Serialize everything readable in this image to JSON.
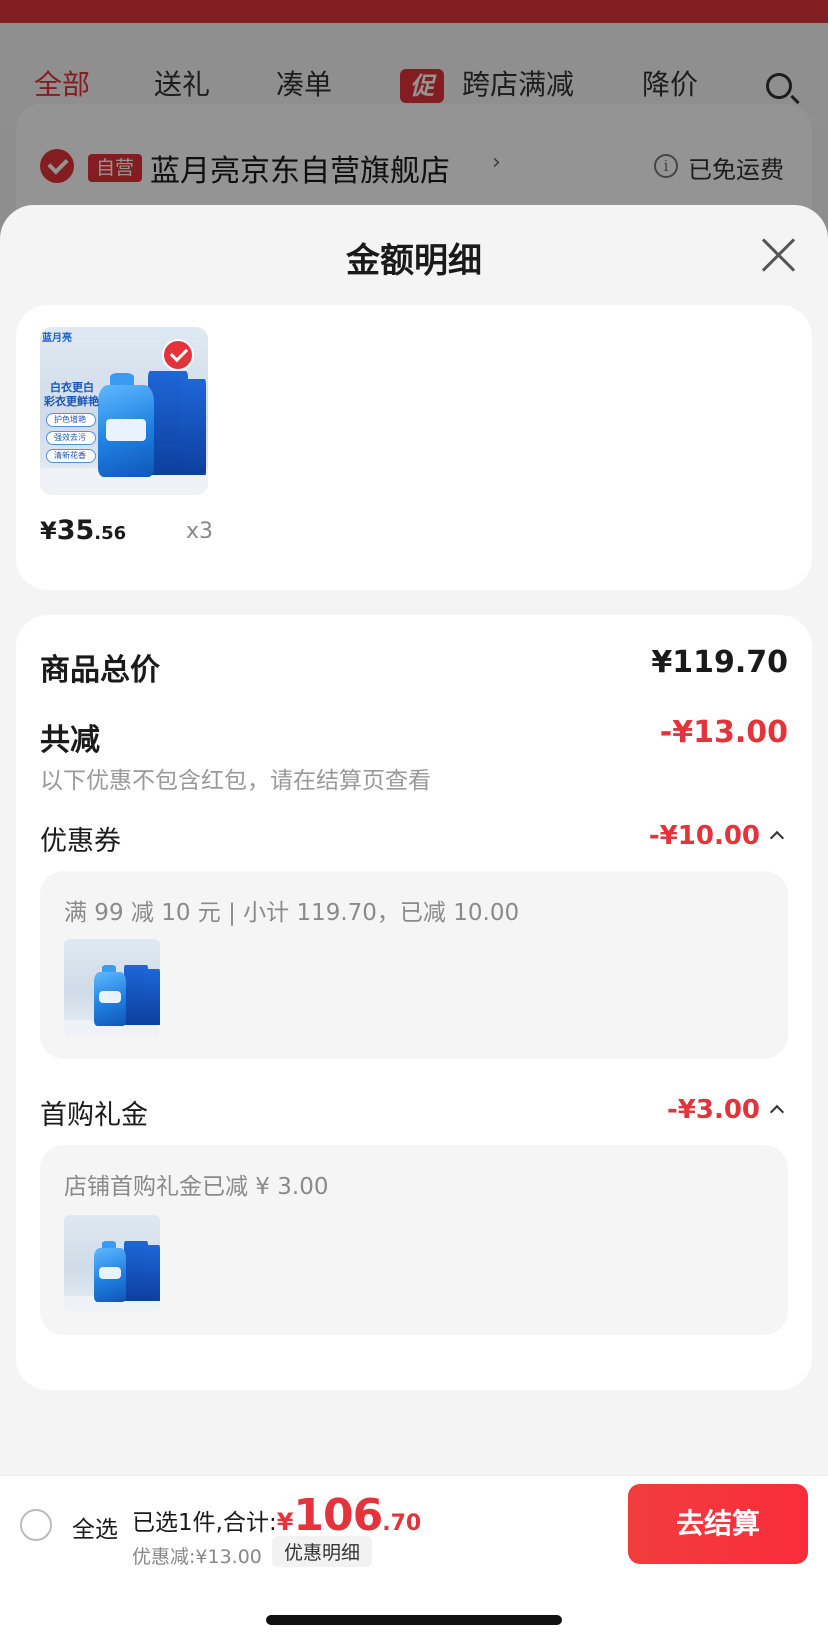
{
  "background": {
    "tabs": [
      {
        "label": "全部",
        "active": true
      },
      {
        "label": "送礼"
      },
      {
        "label": "凑单"
      },
      {
        "label": "跨店满减",
        "badge": "促"
      },
      {
        "label": "降价"
      }
    ],
    "store": {
      "tag": "自营",
      "name": "蓝月亮京东自营旗舰店",
      "arrow": "›",
      "info_icon": "i",
      "shipping": "已免运费"
    }
  },
  "sheet": {
    "title": "金额明细",
    "product": {
      "brand_logo": "蓝月亮",
      "image_texts": [
        "白衣更白",
        "彩衣更鲜艳",
        "护色增艳",
        "强效去污",
        "清新花香"
      ],
      "price_symbol": "¥",
      "price_int": "35",
      "price_dec": ".56",
      "quantity": "x3"
    },
    "summary": {
      "total_label": "商品总价",
      "total_value": "¥119.70",
      "reduce_label": "共减",
      "reduce_value": "-¥13.00",
      "note": "以下优惠不包含红包，请在结算页查看"
    },
    "coupon": {
      "label": "优惠券",
      "value": "-¥10.00",
      "detail": "满 99 减 10 元 | 小计 119.70，已减 10.00"
    },
    "first_gift": {
      "label": "首购礼金",
      "value": "-¥3.00",
      "detail": "店铺首购礼金已减 ¥ 3.00"
    }
  },
  "bottom_bar": {
    "select_all": "全选",
    "summary_prefix": "已选1件,合计:",
    "total_symbol": "¥",
    "total_int": "106",
    "total_dec": ".70",
    "discount": "优惠减:¥13.00",
    "detail_button": "优惠明细",
    "checkout": "去结算"
  },
  "colors": {
    "accent": "#e4333a",
    "checkout": "#f7333c"
  }
}
